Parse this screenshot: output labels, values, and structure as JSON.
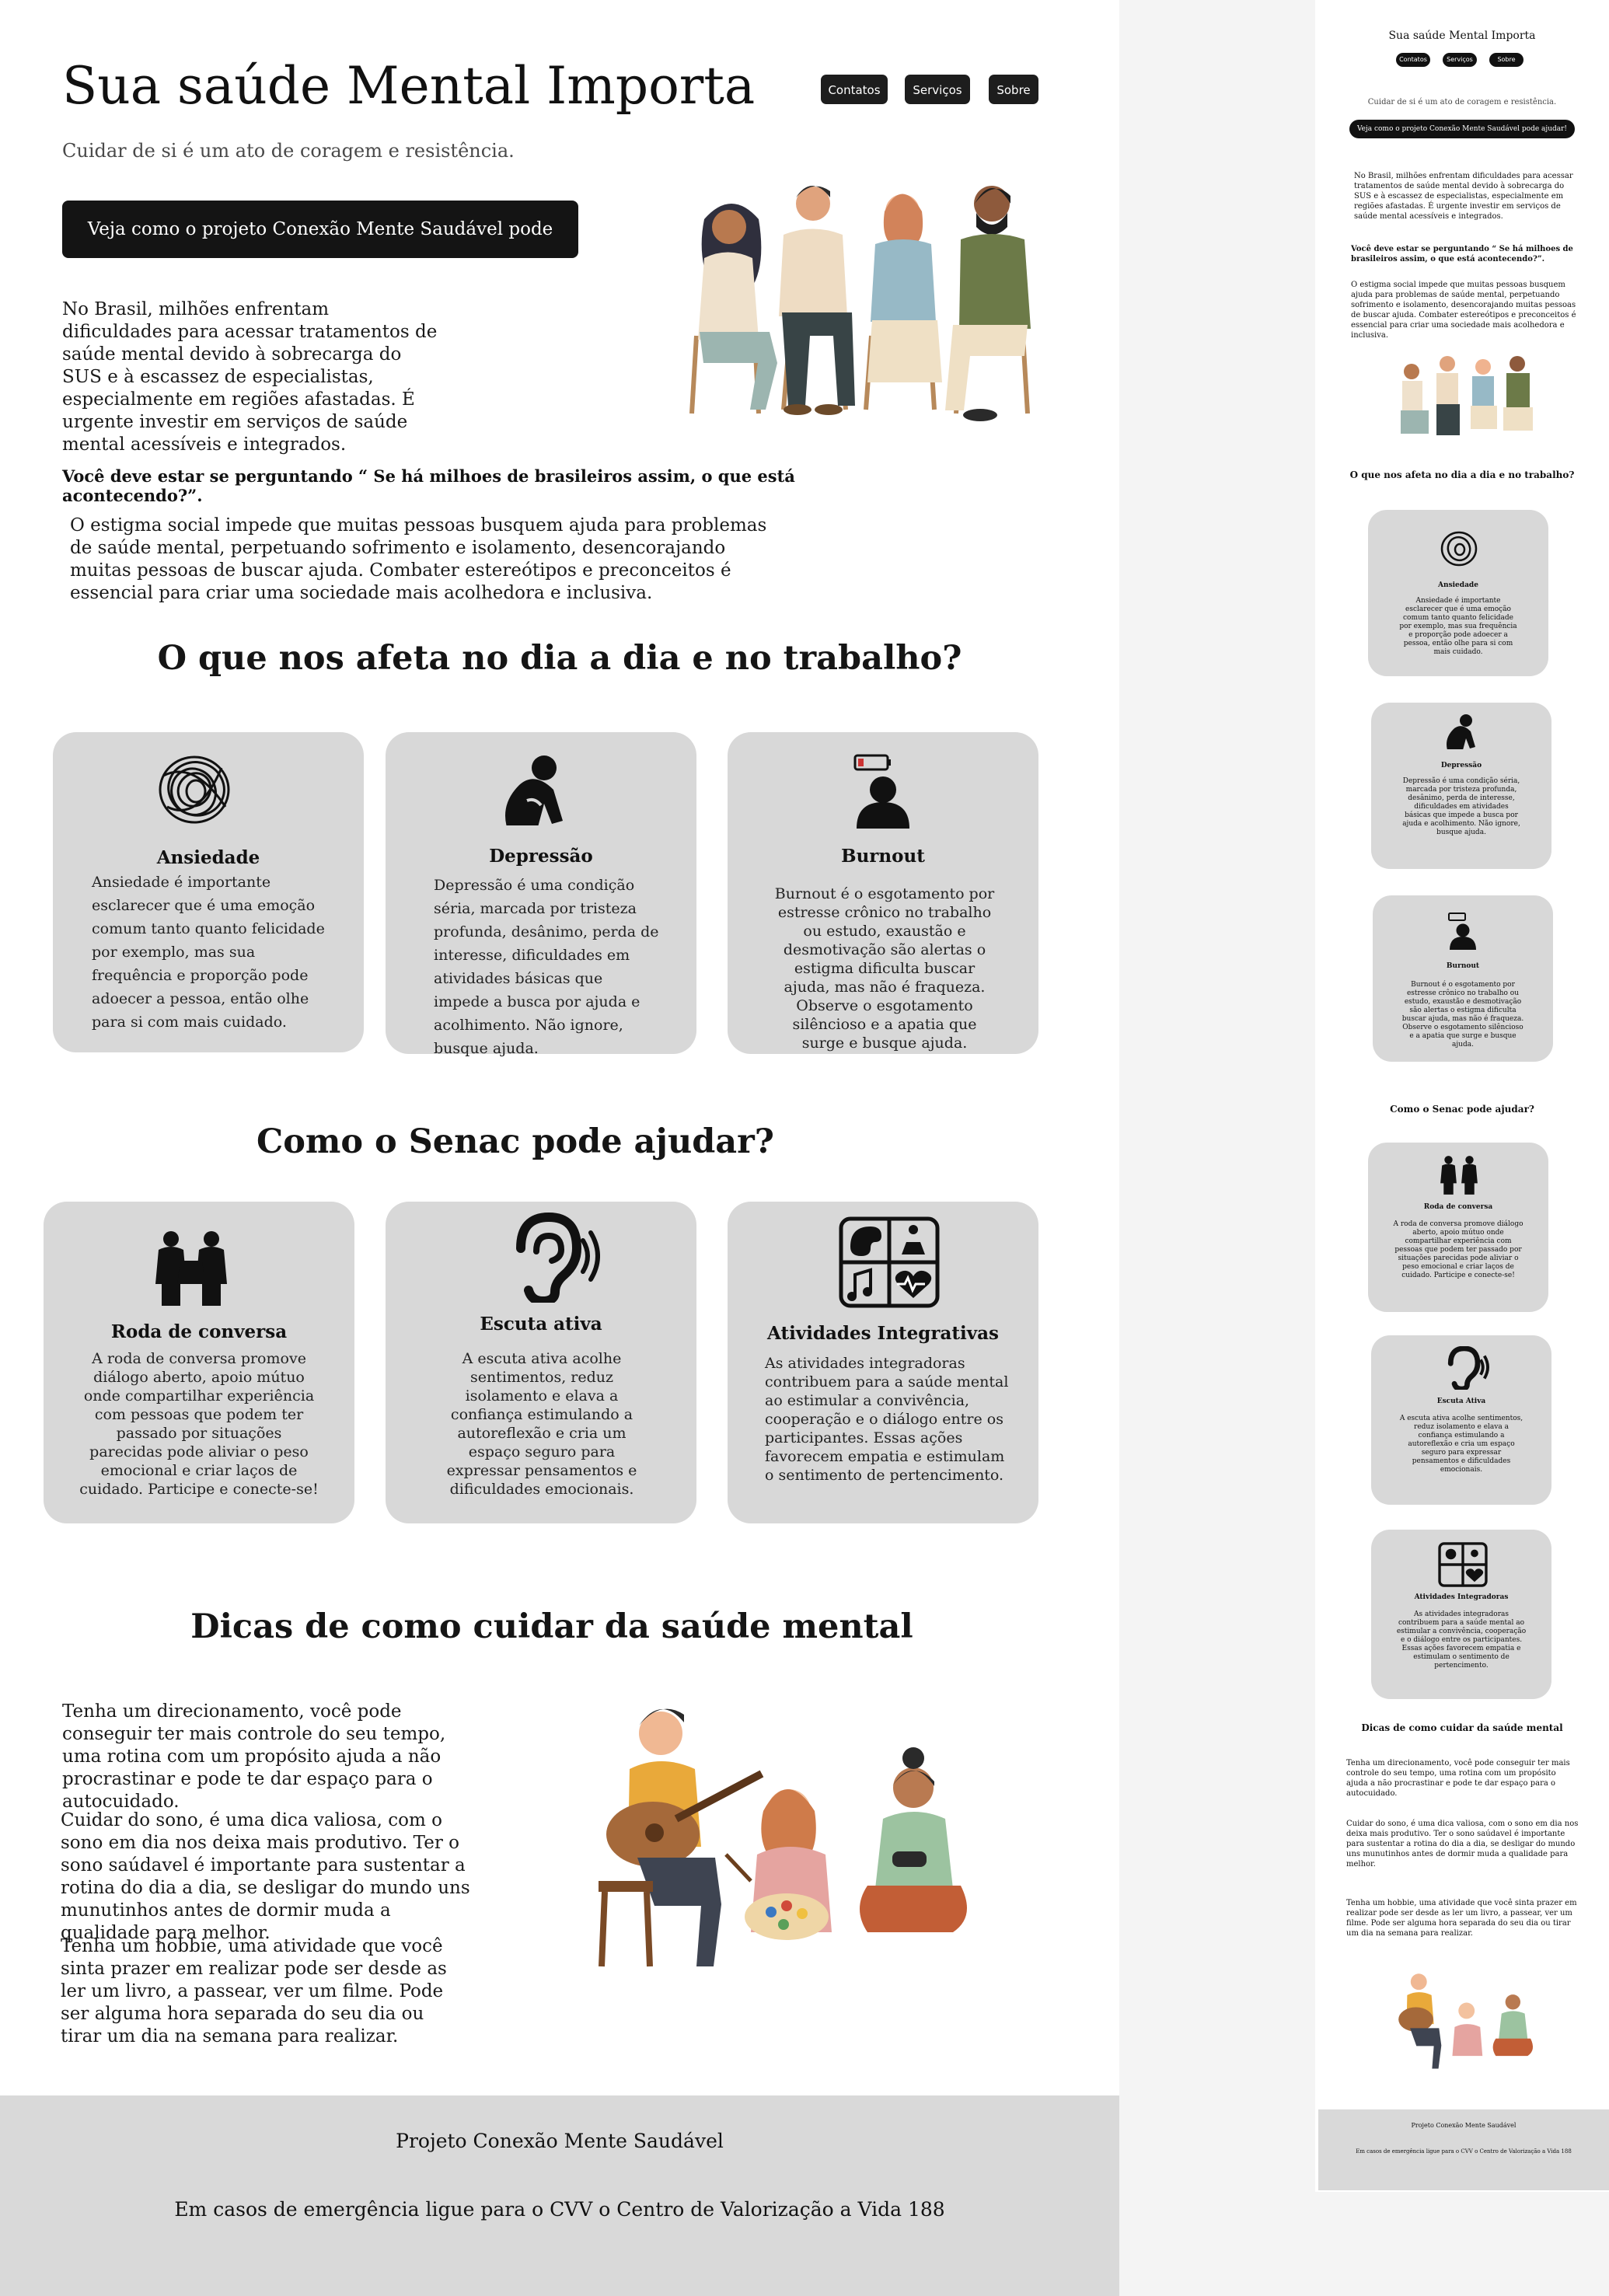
{
  "header": {
    "title": "Sua saúde Mental Importa",
    "nav": [
      "Contatos",
      "Serviços",
      "Sobre"
    ],
    "subtitle": "Cuidar de si é um ato de coragem e resistência.",
    "cta_label": "Veja como o projeto Conexão Mente Saudável pode ajudar!"
  },
  "intro": {
    "paragraph": "No Brasil, milhões enfrentam dificuldades para acessar tratamentos de saúde mental devido à sobrecarga do SUS e à escassez de especialistas, especialmente em regiões afastadas. É urgente investir em serviços de saúde mental acessíveis e integrados.",
    "question": "Você deve estar se perguntando “ Se há milhoes de brasileiros assim, o que está acontecendo?”.",
    "stigma": "O estigma social impede que muitas pessoas busquem ajuda para problemas de saúde mental, perpetuando sofrimento e isolamento, desencorajando muitas pessoas de buscar ajuda. Combater estereótipos e preconceitos é essencial para criar uma sociedade mais acolhedora e inclusiva."
  },
  "affects": {
    "heading": "O que nos afeta no dia a dia e no trabalho?",
    "cards": [
      {
        "title": "Ansiedade",
        "icon": "scribble-icon",
        "text": "Ansiedade é importante esclarecer que é uma emoção comum tanto quanto felicidade por exemplo, mas sua frequência e proporção pode adoecer a pessoa, então olhe para si com mais cuidado."
      },
      {
        "title": "Depressão",
        "icon": "sad-person-icon",
        "text": "Depressão é uma condição séria, marcada por tristeza profunda, desânimo, perda de interesse, dificuldades em atividades básicas que impede a busca por ajuda e acolhimento. Não ignore, busque ajuda."
      },
      {
        "title": "Burnout",
        "icon": "low-battery-person-icon",
        "text": "Burnout é o esgotamento por estresse crônico no trabalho ou estudo, exaustão e desmotivação são alertas o estigma dificulta buscar ajuda, mas não é fraqueza. Observe o esgotamento silêncioso e a apatia que surge e busque ajuda."
      }
    ]
  },
  "help": {
    "heading": "Como o Senac pode ajudar?",
    "cards": [
      {
        "title": "Roda de conversa",
        "icon": "conversation-group-icon",
        "text": "A roda de conversa promove diálogo aberto, apoio mútuo onde compartilhar experiência com pessoas que podem ter passado por situações parecidas pode aliviar o peso emocional e criar laços de cuidado. Participe e conecte-se!"
      },
      {
        "title": "Escuta ativa",
        "icon": "ear-listening-icon",
        "text": "A escuta ativa acolhe sentimentos, reduz isolamento e elava a confiança estimulando a autoreflexão e cria um espaço seguro para expressar pensamentos e dificuldades emocionais."
      },
      {
        "title": "Atividades Integrativas",
        "icon": "activities-grid-icon",
        "text": "As atividades integradoras contribuem para a saúde mental ao estimular a convivência, cooperação e o diálogo entre os participantes. Essas ações favorecem empatia e estimulam o sentimento de pertencimento."
      }
    ]
  },
  "tips": {
    "heading": "Dicas de como cuidar da saúde mental",
    "paragraphs": [
      "Tenha um direcionamento, você pode conseguir  ter mais controle do seu tempo, uma rotina com um propósito ajuda a não procrastinar e pode te dar espaço para o autocuidado.",
      "Cuidar do sono, é uma dica valiosa, com o sono em dia nos deixa mais produtivo. Ter o sono saúdavel é importante para sustentar a rotina do dia a dia, se desligar do mundo uns munutinhos antes de dormir muda a qualidade para melhor.",
      "Tenha um hobbie, uma atividade que você sinta prazer em realizar  pode ser desde as ler um livro, a passear, ver um filme. Pode ser alguma hora separada do seu dia ou tirar um dia na semana para realizar."
    ]
  },
  "footer": {
    "project": "Projeto Conexão Mente Saudável",
    "emergency": "Em casos de emergência ligue para o CVV o Centro de Valorização a Vida 188"
  },
  "mobile": {
    "title": "Sua saúde Mental Importa",
    "help_card2_title": "Escuta Ativa",
    "help_card3_title": "Atividades Integradoras"
  }
}
